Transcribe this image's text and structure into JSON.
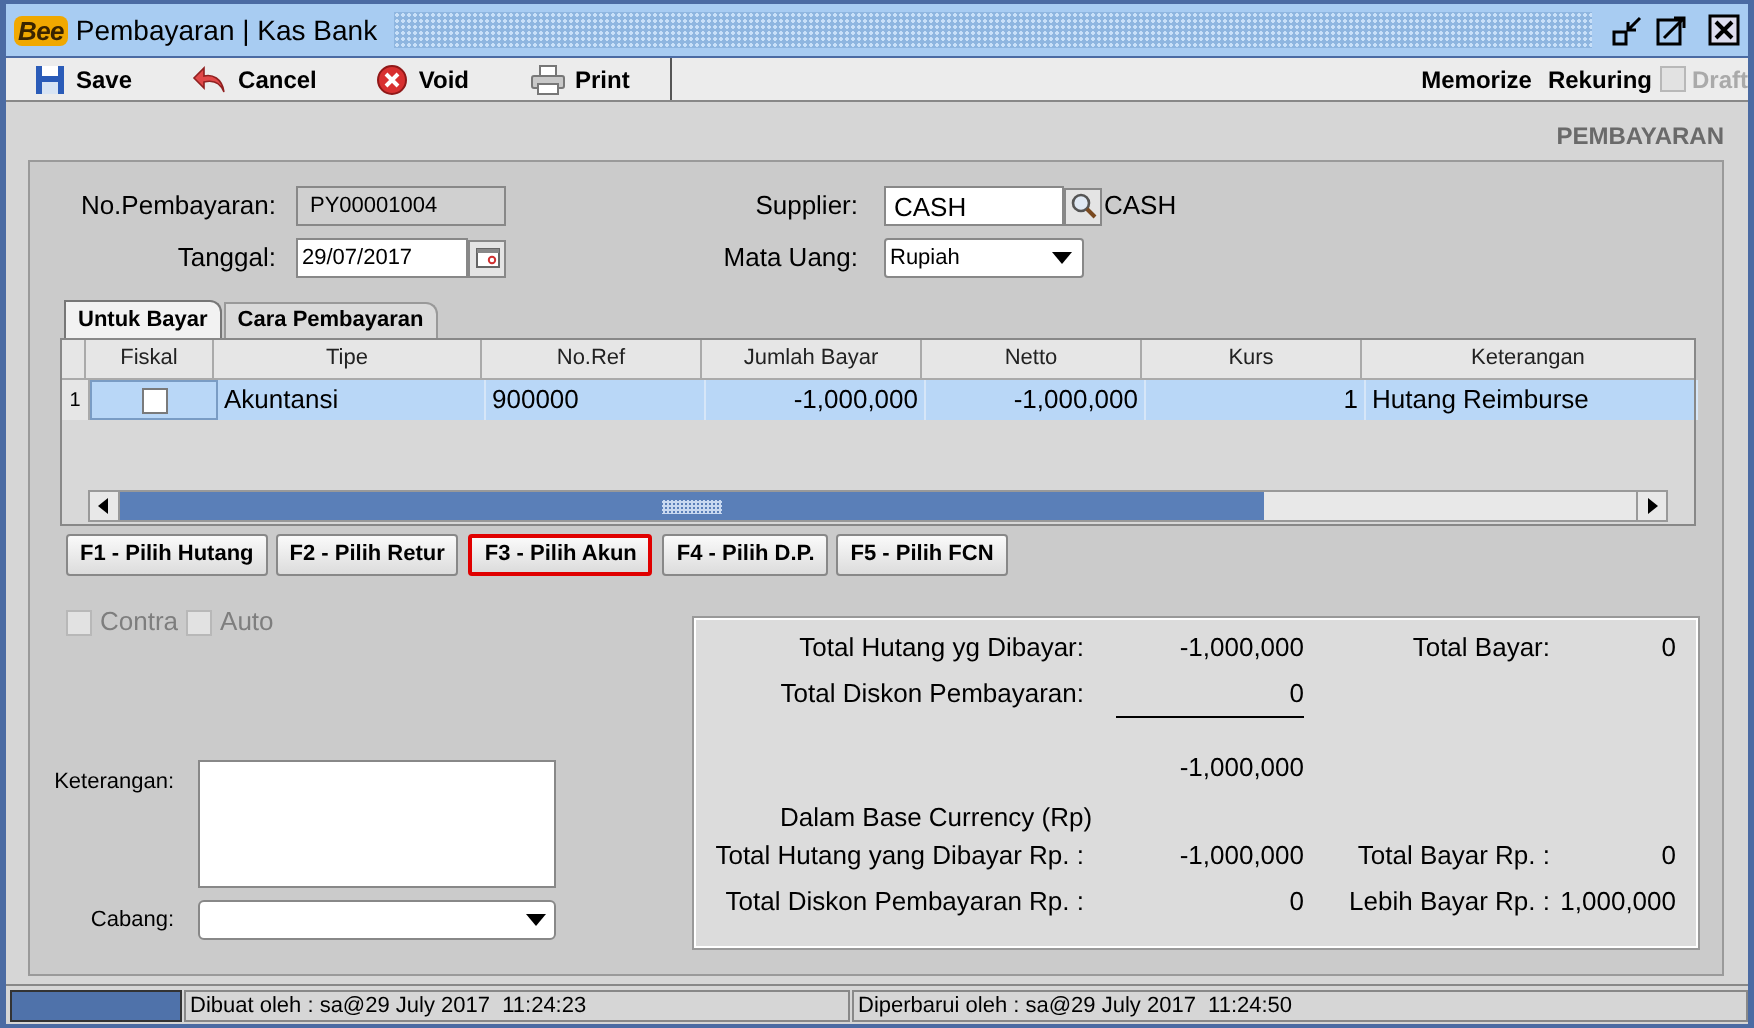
{
  "window": {
    "logo": "Bee",
    "title": "Pembayaran | Kas Bank"
  },
  "toolbar": {
    "buttons": [
      {
        "kind": "save",
        "label": "Save"
      },
      {
        "kind": "cancel",
        "label": "Cancel"
      },
      {
        "kind": "void",
        "label": "Void"
      },
      {
        "kind": "print",
        "label": "Print"
      }
    ],
    "memorize": "Memorize",
    "rekuring": "Rekuring",
    "draft": {
      "label": "Draft",
      "checked": false,
      "disabled": true
    }
  },
  "form_title": "PEMBAYARAN",
  "form": {
    "no_pembayaran": {
      "label": "No.Pembayaran:",
      "value": "PY00001004"
    },
    "tanggal": {
      "label": "Tanggal:",
      "value": "29/07/2017"
    },
    "supplier": {
      "label": "Supplier:",
      "value": "CASH",
      "name": "CASH"
    },
    "mata_uang": {
      "label": "Mata Uang:",
      "value": "Rupiah"
    }
  },
  "tabs": [
    {
      "label": "Untuk Bayar",
      "selected": true
    },
    {
      "label": "Cara Pembayaran",
      "selected": false
    }
  ],
  "table": {
    "columns": [
      "Fiskal",
      "Tipe",
      "No.Ref",
      "Jumlah Bayar",
      "Netto",
      "Kurs",
      "Keterangan"
    ],
    "rows": [
      {
        "number": "1",
        "selected": true,
        "fiskal_checked": false,
        "cells": [
          "",
          "Akuntansi",
          "900000",
          "-1,000,000",
          "-1,000,000",
          "1",
          "Hutang Reimburse"
        ]
      }
    ]
  },
  "action_buttons": [
    {
      "label": "F1 - Pilih Hutang",
      "highlighted": false
    },
    {
      "label": "F2 - Pilih Retur",
      "highlighted": false
    },
    {
      "label": "F3 - Pilih Akun",
      "highlighted": true
    },
    {
      "label": "F4 - Pilih D.P.",
      "highlighted": false
    },
    {
      "label": "F5 - Pilih FCN",
      "highlighted": false
    }
  ],
  "options": [
    {
      "label": "Contra",
      "checked": false,
      "disabled": true
    },
    {
      "label": "Auto",
      "checked": false,
      "disabled": true
    }
  ],
  "keterangan": {
    "label": "Keterangan:"
  },
  "cabang": {
    "label": "Cabang:"
  },
  "summary": [
    {
      "kind": "line",
      "label": "Total Hutang yg Dibayar:",
      "value": "-1,000,000",
      "label_2": "Total Bayar:",
      "value_2": "0"
    },
    {
      "kind": "underlined",
      "label": "Total Diskon Pembayaran:",
      "value": "0"
    },
    {
      "kind": "result",
      "value": "-1,000,000"
    },
    {
      "kind": "heading",
      "label": "Dalam Base Currency (Rp)"
    },
    {
      "kind": "line",
      "label": "Total Hutang yang Dibayar Rp. :",
      "value": "-1,000,000",
      "label_2": "Total Bayar Rp. :",
      "value_2": "0"
    },
    {
      "kind": "line",
      "label": "Total Diskon Pembayaran Rp. :",
      "value": "0",
      "label_2": "Lebih Bayar Rp. :",
      "value_2": "1,000,000"
    }
  ],
  "status_bar": {
    "progress": {
      "level": 1
    },
    "created": "Dibuat oleh : sa@29 July 2017  11:24:23",
    "updated": "Diperbarui oleh : sa@29 July 2017  11:24:50"
  }
}
